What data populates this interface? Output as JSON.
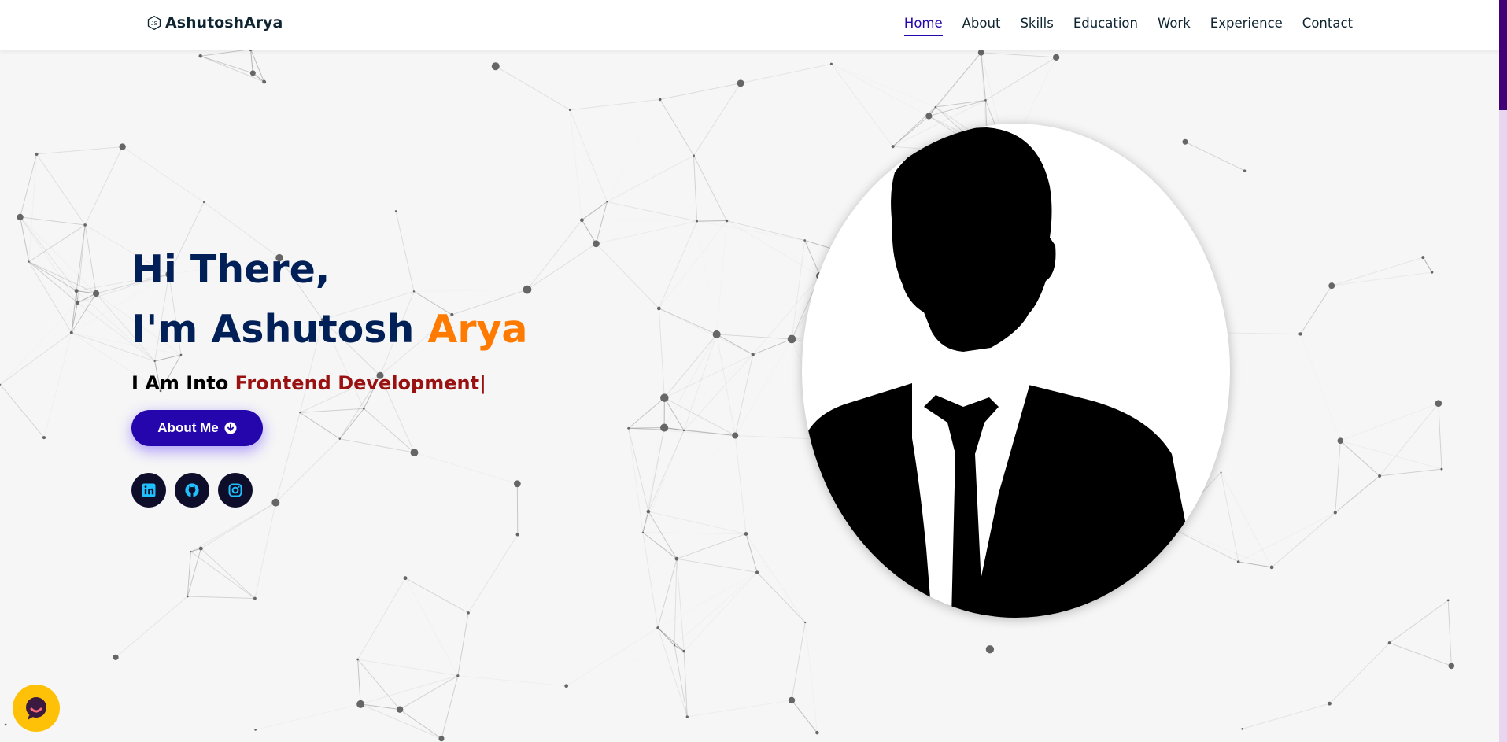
{
  "header": {
    "logo_text": "AshutoshArya",
    "nav": [
      {
        "label": "Home",
        "active": true
      },
      {
        "label": "About"
      },
      {
        "label": "Skills"
      },
      {
        "label": "Education"
      },
      {
        "label": "Work"
      },
      {
        "label": "Experience"
      },
      {
        "label": "Contact"
      }
    ]
  },
  "hero": {
    "greeting": "Hi There,",
    "name_prefix": "I'm Ashutosh ",
    "name_accent": "Arya",
    "typed_prefix": "I Am Into ",
    "typed_value": "Frontend Development",
    "cursor": "|",
    "button_label": "About Me"
  },
  "socials": [
    {
      "icon": "linkedin-icon"
    },
    {
      "icon": "github-icon"
    },
    {
      "icon": "instagram-icon"
    }
  ],
  "colors": {
    "primary": "#2506ad",
    "heading": "#002057",
    "accent": "#ff7a00",
    "typed": "#991111",
    "chat": "#ffc107"
  }
}
